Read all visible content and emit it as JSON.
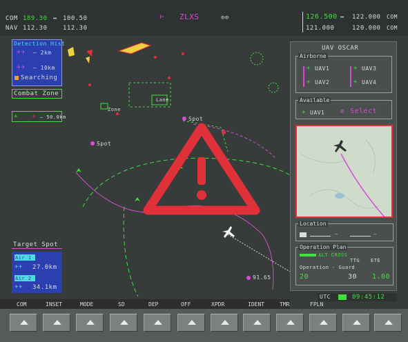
{
  "top": {
    "com_label": "COM",
    "com_active": "189.30",
    "com_sep": "↔",
    "com_standby": "100.50",
    "nav_label": "NAV",
    "nav_active": "112.30",
    "nav_standby": "112.30",
    "heading_readout": "ZLXS",
    "center_text": "⊙⊙",
    "freq_right_1": "126.500",
    "freq_right_1_sep": "↔",
    "freq_right_1_sb": "122.000",
    "freq_right_1_unit": "COM",
    "freq_right_2": "121.000",
    "freq_right_2_sb": "120.000",
    "freq_right_2_unit": "COM"
  },
  "legend": {
    "title": "Detection Hist",
    "row1": "— 2km",
    "row2": "— 10km",
    "row3": "Searching",
    "combat_zone": "Combat Zone"
  },
  "small_legend": {
    "label": "— 50.0km"
  },
  "map_labels": {
    "waypoint_a": "Zone",
    "waypoint_b": "Spot",
    "waypoint_c": "Spot",
    "waypoint_d": "Lane",
    "bottom_label": "91.65",
    "alert_label": "Alert"
  },
  "target_spot": {
    "title": "Target Spot",
    "item1_tag": "Air 1",
    "item1_value": "27.0km",
    "item2_tag": "Air 2",
    "item2_value": "34.1km"
  },
  "uav_panel": {
    "title": "UAV OSCAR",
    "airborne_title": "Airborne",
    "uav1": "UAV1",
    "uav2": "UAV2",
    "uav3": "UAV3",
    "uav4": "UAV4",
    "available_title": "Available",
    "avail1": "UAV1",
    "avail_select": "Select",
    "location_title": "Location",
    "location_value_a": "—",
    "location_value_b": "—",
    "op_title": "Operation Plan",
    "op_line1": "ALT CROSS",
    "op_line2": "Operation - Guard",
    "op_val1": "20",
    "op_val2": "30",
    "op_val3": "1.00",
    "op_lbl1": "TTG",
    "op_lbl2": "ETE"
  },
  "status_bar": {
    "label": "UTC",
    "time": "09:45:12"
  },
  "softkeys": [
    "COM",
    "INSET",
    "MODE",
    "SD",
    "DEP",
    "OFF",
    "XPDR",
    "IDENT",
    "TMR",
    "FPLN"
  ],
  "colors": {
    "green": "#3fe03f",
    "magenta": "#d24fd2",
    "cyan": "#4fd8e0",
    "warning_red": "#e0303a",
    "yellow": "#f0d040"
  }
}
